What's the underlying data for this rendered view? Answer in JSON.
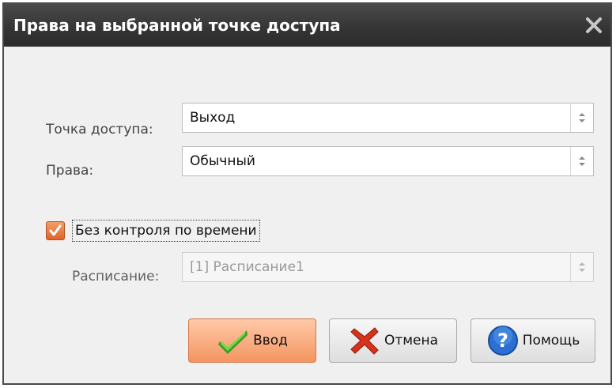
{
  "dialog": {
    "title": "Права на выбранной точке доступа"
  },
  "form": {
    "access_point": {
      "label": "Точка доступа:",
      "value": "Выход"
    },
    "rights": {
      "label": "Права:",
      "value": "Обычный"
    },
    "no_time_control": {
      "label": "Без контроля по времени",
      "checked": true
    },
    "schedule": {
      "label": "Расписание:",
      "value": "[1] Расписание1",
      "disabled": true
    }
  },
  "buttons": {
    "ok": "Ввод",
    "cancel": "Отмена",
    "help": "Помощь"
  },
  "colors": {
    "titlebar": "#333333",
    "accent": "#f4955f",
    "checkbox": "#e0642a"
  }
}
